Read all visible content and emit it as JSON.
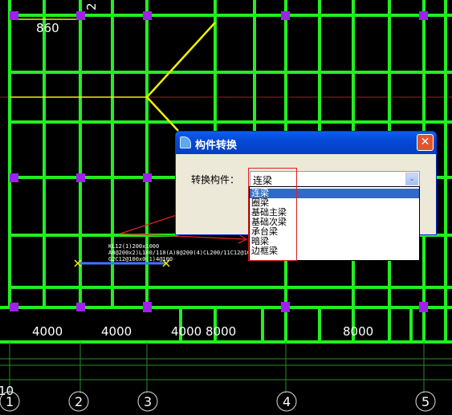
{
  "drawing": {
    "dim_top": "860",
    "dim_bottom": [
      "4000",
      "4000",
      "4000",
      "8000",
      "8000"
    ],
    "axis_labels": [
      "1",
      "2",
      "3",
      "4",
      "5"
    ],
    "left_edge_text": "10",
    "top_vertical_text": "2",
    "beam_annotation": [
      "KL12(1)200x1000",
      "A8@200x2)L100/110(A)8@200(4)CL200/11C12@100",
      "G2C12@100x0(1)4@100"
    ],
    "colors": {
      "grid": "#22ee22",
      "column": "#a020f0",
      "yellow_line": "#f0f000",
      "arrow": "#e02020"
    }
  },
  "dialog": {
    "title": "构件转换",
    "close_symbol": "✕",
    "convert_label": "转换构件：",
    "combo_value": "连梁",
    "combo_arrow": "⌄",
    "options": [
      "连梁",
      "圈梁",
      "基础主梁",
      "基础次梁",
      "承台梁",
      "暗梁",
      "边框梁"
    ],
    "selected_index": 0
  }
}
